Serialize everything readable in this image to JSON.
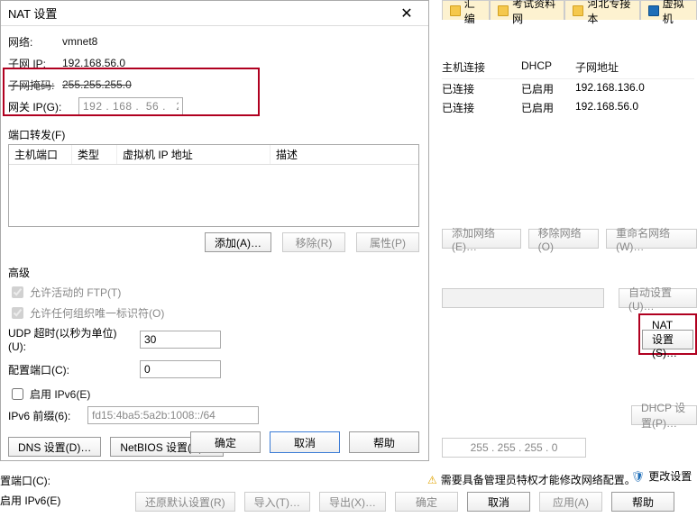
{
  "dialog": {
    "title": "NAT 设置",
    "network_label": "网络:",
    "network_value": "vmnet8",
    "subnet_ip_label": "子网 IP:",
    "subnet_ip_value": "192.168.56.0",
    "subnet_mask_label": "子网掩码:",
    "subnet_mask_value": "255.255.255.0",
    "gateway_label": "网关 IP(G):",
    "gateway_value": "192 . 168 .  56 .   2",
    "port_fwd_header": "端口转发(F)",
    "cols": {
      "c1": "主机端口",
      "c2": "类型",
      "c3": "虚拟机 IP 地址",
      "c4": "描述"
    },
    "add": "添加(A)…",
    "remove": "移除(R)",
    "props": "属性(P)",
    "advanced": "高级",
    "allow_ftp": "允许活动的 FTP(T)",
    "allow_oui": "允许任何组织唯一标识符(O)",
    "udp_label": "UDP 超时(以秒为单位)(U):",
    "udp_value": "30",
    "cfg_port_label": "配置端口(C):",
    "cfg_port_value": "0",
    "enable_ipv6": "启用 IPv6(E)",
    "ipv6_prefix_label": "IPv6 前缀(6):",
    "ipv6_prefix_value": "fd15:4ba5:5a2b:1008::/64",
    "dns_btn": "DNS 设置(D)…",
    "netbios_btn": "NetBIOS 设置(N)…",
    "ok": "确定",
    "cancel": "取消",
    "help": "帮助"
  },
  "bg": {
    "tabs": {
      "t1": "汇编",
      "t2": "考试资料网",
      "t3": "河北专接本",
      "t4": "虚拟机"
    },
    "thead": {
      "h1": "主机连接",
      "h2": "DHCP",
      "h3": "子网地址"
    },
    "rows": [
      {
        "c1": "已连接",
        "c2": "已启用",
        "c3": "192.168.136.0"
      },
      {
        "c1": "已连接",
        "c2": "已启用",
        "c3": "192.168.56.0"
      }
    ],
    "add_net": "添加网络(E)…",
    "rm_net": "移除网络(O)",
    "rn_net": "重命名网络(W)…",
    "auto_set": "自动设置(U)…",
    "nat_set": "NAT 设置(S)…",
    "dhcp_set": "DHCP 设置(P)…",
    "ipseg": "255 . 255 . 255 .   0",
    "notice": "需要具备管理员特权才能修改网络配置。",
    "change_set": "更改设置",
    "restore": "还原默认设置(R)",
    "import": "导入(T)…",
    "export": "导出(X)…",
    "ok": "确定",
    "cancel": "取消",
    "apply": "应用(A)",
    "help": "帮助",
    "cfg_port_label": "置端口(C):",
    "enable_ipv6": "启用 IPv6(E)"
  }
}
